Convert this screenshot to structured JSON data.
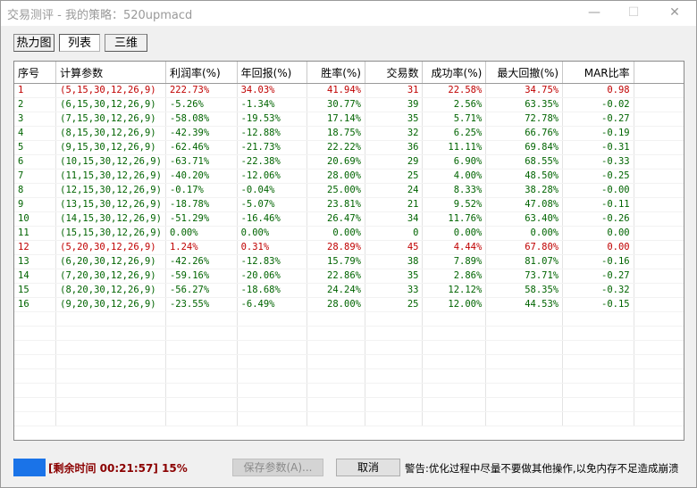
{
  "window": {
    "title": "交易测评 - 我的策略：520upmacd",
    "minimize": "—",
    "maximize": "☐",
    "close": "✕"
  },
  "tabs": [
    {
      "label": "热力图",
      "active": false
    },
    {
      "label": "列表",
      "active": true
    },
    {
      "label": "三维",
      "active": false
    }
  ],
  "table": {
    "headers": [
      "序号",
      "计算参数",
      "利润率(%)",
      "年回报(%)",
      "胜率(%)",
      "交易数",
      "成功率(%)",
      "最大回撤(%)",
      "MAR比率"
    ],
    "rows": [
      {
        "color": "red",
        "cells": [
          "1",
          "(5,15,30,12,26,9)",
          "222.73%",
          "34.03%",
          "41.94%",
          "31",
          "22.58%",
          "34.75%",
          "0.98"
        ]
      },
      {
        "color": "green",
        "cells": [
          "2",
          "(6,15,30,12,26,9)",
          "-5.26%",
          "-1.34%",
          "30.77%",
          "39",
          "2.56%",
          "63.35%",
          "-0.02"
        ]
      },
      {
        "color": "green",
        "cells": [
          "3",
          "(7,15,30,12,26,9)",
          "-58.08%",
          "-19.53%",
          "17.14%",
          "35",
          "5.71%",
          "72.78%",
          "-0.27"
        ]
      },
      {
        "color": "green",
        "cells": [
          "4",
          "(8,15,30,12,26,9)",
          "-42.39%",
          "-12.88%",
          "18.75%",
          "32",
          "6.25%",
          "66.76%",
          "-0.19"
        ]
      },
      {
        "color": "green",
        "cells": [
          "5",
          "(9,15,30,12,26,9)",
          "-62.46%",
          "-21.73%",
          "22.22%",
          "36",
          "11.11%",
          "69.84%",
          "-0.31"
        ]
      },
      {
        "color": "green",
        "cells": [
          "6",
          "(10,15,30,12,26,9)",
          "-63.71%",
          "-22.38%",
          "20.69%",
          "29",
          "6.90%",
          "68.55%",
          "-0.33"
        ]
      },
      {
        "color": "green",
        "cells": [
          "7",
          "(11,15,30,12,26,9)",
          "-40.20%",
          "-12.06%",
          "28.00%",
          "25",
          "4.00%",
          "48.50%",
          "-0.25"
        ]
      },
      {
        "color": "green",
        "cells": [
          "8",
          "(12,15,30,12,26,9)",
          "-0.17%",
          "-0.04%",
          "25.00%",
          "24",
          "8.33%",
          "38.28%",
          "-0.00"
        ]
      },
      {
        "color": "green",
        "cells": [
          "9",
          "(13,15,30,12,26,9)",
          "-18.78%",
          "-5.07%",
          "23.81%",
          "21",
          "9.52%",
          "47.08%",
          "-0.11"
        ]
      },
      {
        "color": "green",
        "cells": [
          "10",
          "(14,15,30,12,26,9)",
          "-51.29%",
          "-16.46%",
          "26.47%",
          "34",
          "11.76%",
          "63.40%",
          "-0.26"
        ]
      },
      {
        "color": "green",
        "cells": [
          "11",
          "(15,15,30,12,26,9)",
          "0.00%",
          "0.00%",
          "0.00%",
          "0",
          "0.00%",
          "0.00%",
          "0.00"
        ]
      },
      {
        "color": "red",
        "cells": [
          "12",
          "(5,20,30,12,26,9)",
          "1.24%",
          "0.31%",
          "28.89%",
          "45",
          "4.44%",
          "67.80%",
          "0.00"
        ]
      },
      {
        "color": "green",
        "cells": [
          "13",
          "(6,20,30,12,26,9)",
          "-42.26%",
          "-12.83%",
          "15.79%",
          "38",
          "7.89%",
          "81.07%",
          "-0.16"
        ]
      },
      {
        "color": "green",
        "cells": [
          "14",
          "(7,20,30,12,26,9)",
          "-59.16%",
          "-20.06%",
          "22.86%",
          "35",
          "2.86%",
          "73.71%",
          "-0.27"
        ]
      },
      {
        "color": "green",
        "cells": [
          "15",
          "(8,20,30,12,26,9)",
          "-56.27%",
          "-18.68%",
          "24.24%",
          "33",
          "12.12%",
          "58.35%",
          "-0.32"
        ]
      },
      {
        "color": "green",
        "cells": [
          "16",
          "(9,20,30,12,26,9)",
          "-23.55%",
          "-6.49%",
          "28.00%",
          "25",
          "12.00%",
          "44.53%",
          "-0.15"
        ]
      }
    ],
    "empty_rows": 8
  },
  "bottom": {
    "progress_percent": 15,
    "status_text": "[剩余时间 00:21:57] 15%",
    "save_label": "保存参数(A)...",
    "cancel_label": "取消",
    "warning_text": "警告:优化过程中尽量不要做其他操作,以免内存不足造成崩溃"
  },
  "colors": {
    "red_row": "#c00000",
    "green_row": "#006400",
    "progress": "#1a73e8"
  }
}
